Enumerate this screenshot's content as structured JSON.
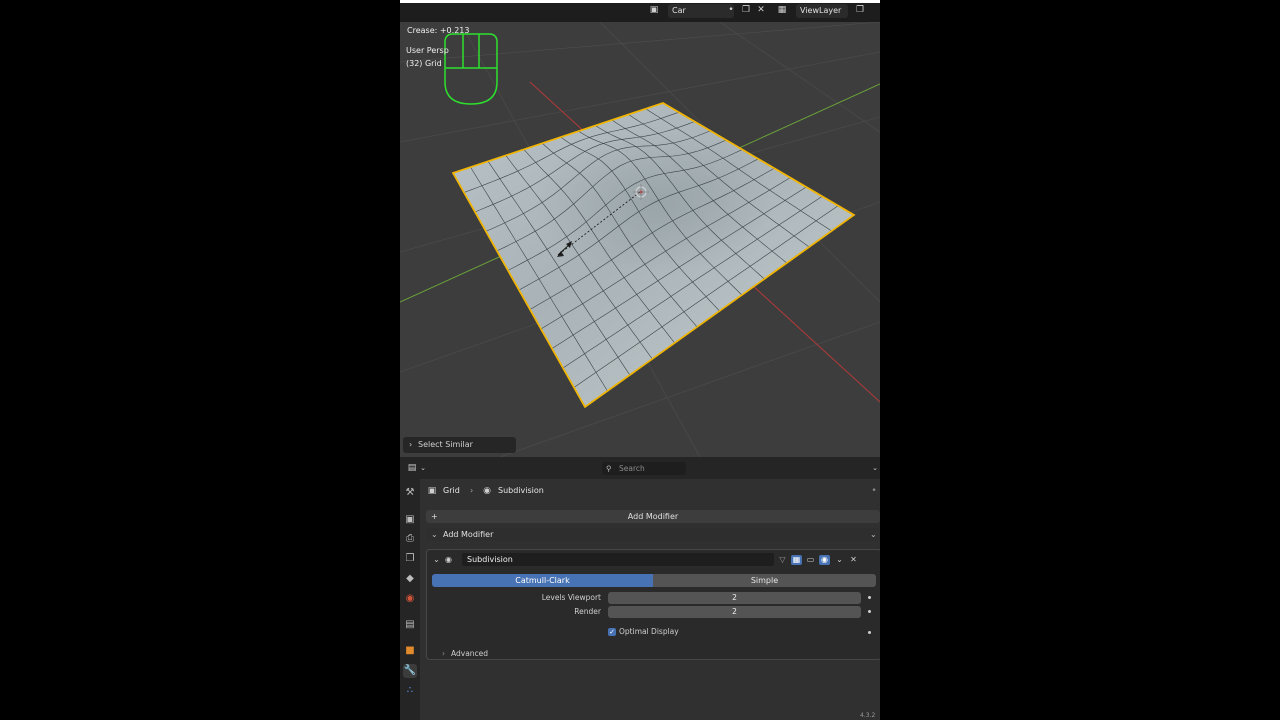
{
  "header": {
    "scene_name": "Car",
    "view_layer": "ViewLayer"
  },
  "viewport": {
    "crease_readout": "Crease: +0.213",
    "view_name": "User Persp",
    "object_info": "(32) Grid",
    "last_operator": "Select Similar"
  },
  "properties": {
    "search_placeholder": "Search",
    "breadcrumb": {
      "object": "Grid",
      "modifier": "Subdivision"
    },
    "add_modifier_button": "Add Modifier",
    "add_modifier_menu": "Add Modifier",
    "modifier": {
      "name": "Subdivision",
      "mode_options": [
        "Catmull-Clark",
        "Simple"
      ],
      "selected_mode": "Catmull-Clark",
      "levels_viewport_label": "Levels Viewport",
      "levels_viewport_value": "2",
      "render_label": "Render",
      "render_value": "2",
      "optimal_display_label": "Optimal Display",
      "optimal_display_checked": true,
      "advanced_label": "Advanced"
    }
  },
  "footer": {
    "version": "4.3.2"
  },
  "colors": {
    "accent": "#4772b3",
    "selection_outline": "#f0b400",
    "x_axis": "#b23a3a",
    "y_axis": "#6aa23a"
  }
}
